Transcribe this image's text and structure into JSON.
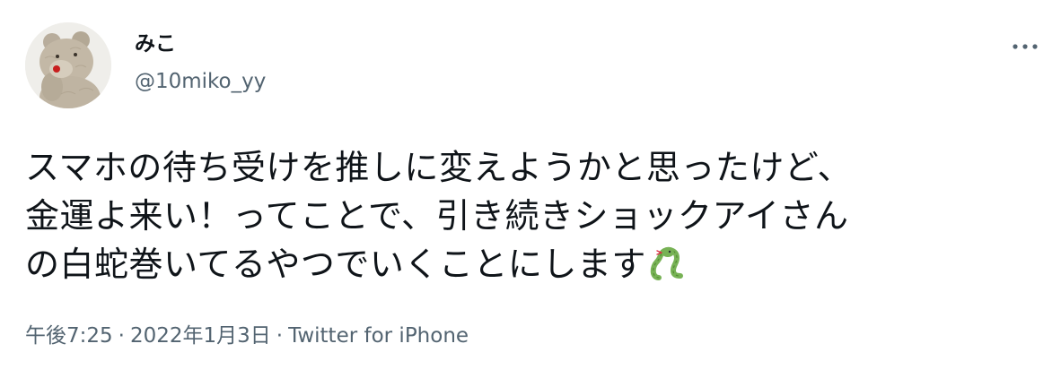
{
  "user": {
    "display_name": "みこ",
    "handle": "@10miko_yy",
    "avatar_icon": "crochet-bear-avatar"
  },
  "more_icon": "more-horizontal-icon",
  "tweet": {
    "lines": [
      "スマホの待ち受けを推しに変えようかと思ったけど、",
      "金運よ来い！ってことで、引き続きショックアイさん",
      "の白蛇巻いてるやつでいくことにします"
    ],
    "emoji": "snake-emoji"
  },
  "meta": {
    "time": "午後7:25",
    "separator": "·",
    "date": "2022年1月3日",
    "source": "Twitter for iPhone"
  },
  "colors": {
    "text": "#0f1419",
    "secondary": "#536471",
    "snake": "#77b255"
  }
}
